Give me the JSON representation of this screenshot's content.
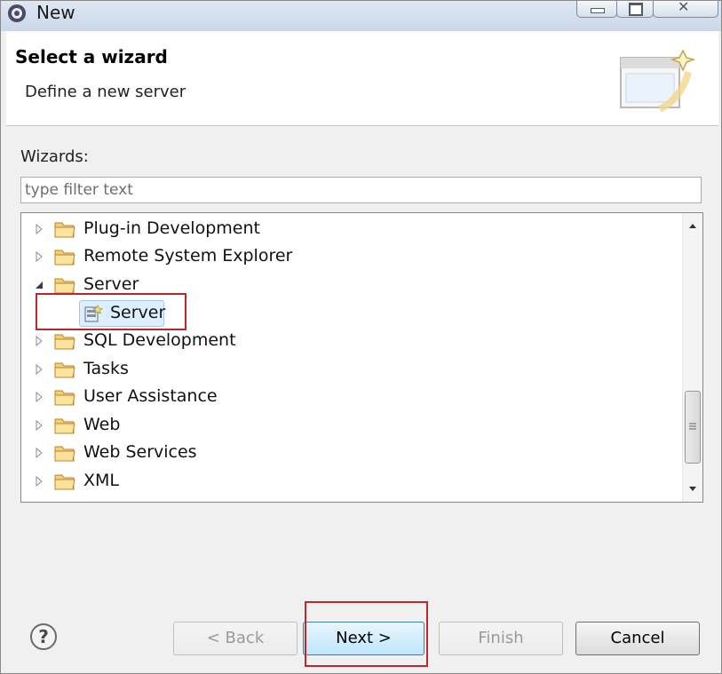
{
  "window": {
    "title": "New"
  },
  "header": {
    "title": "Select a wizard",
    "subtitle": "Define a new server"
  },
  "wizards": {
    "label": "Wizards:",
    "filter_placeholder": "type filter text",
    "filter_value": ""
  },
  "tree": {
    "items": [
      {
        "label": "Plug-in Development",
        "expanded": false
      },
      {
        "label": "Remote System Explorer",
        "expanded": false
      },
      {
        "label": "Server",
        "expanded": true,
        "children": [
          {
            "label": "Server",
            "selected": true
          }
        ]
      },
      {
        "label": "SQL Development",
        "expanded": false
      },
      {
        "label": "Tasks",
        "expanded": false
      },
      {
        "label": "User Assistance",
        "expanded": false
      },
      {
        "label": "Web",
        "expanded": false
      },
      {
        "label": "Web Services",
        "expanded": false
      },
      {
        "label": "XML",
        "expanded": false
      }
    ]
  },
  "buttons": {
    "back": "< Back",
    "next": "Next >",
    "finish": "Finish",
    "cancel": "Cancel"
  },
  "colors": {
    "highlight": "#c0272d",
    "selection": "#ddeeff",
    "folder": "#e8b64a"
  }
}
